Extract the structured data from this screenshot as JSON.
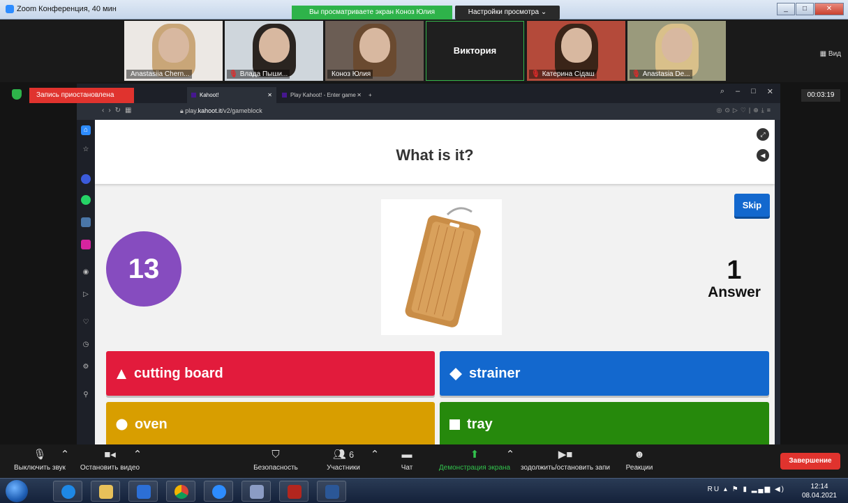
{
  "zoom": {
    "window_title": "Zoom Конференция, 40 мин",
    "share_notice": "Вы просматриваете экран Коноз Юлия",
    "view_options": "Настройки просмотра",
    "view_label": "Вид",
    "recording_status": "Запись приостановлена",
    "timer": "00:03:19",
    "participants": [
      {
        "name": "Anastasiia Chern...",
        "muted": false,
        "hair": "#c9a678",
        "bg": "#ece8e4"
      },
      {
        "name": "Влада Пыши...",
        "muted": true,
        "hair": "#2a2420",
        "bg": "#cfd6dc"
      },
      {
        "name": "Коноз Юлия",
        "muted": false,
        "hair": "#6a4a30",
        "bg": "#6b5d54"
      },
      {
        "name": "Виктория",
        "muted": false,
        "text_only": true
      },
      {
        "name": "Катерина Сідаш",
        "muted": true,
        "hair": "#3a2418",
        "bg": "#b44a3a"
      },
      {
        "name": "Anastasia De...",
        "muted": true,
        "hair": "#d9c08a",
        "bg": "#9a9a7c"
      }
    ],
    "toolbar": {
      "mute": "Выключить звук",
      "stop_video": "Остановить видео",
      "security": "Безопасность",
      "participants": "Участники",
      "participants_count": "6",
      "chat": "Чат",
      "share_screen": "Демонстрация экрана",
      "record": "зодолжить/остановить запи",
      "reactions": "Реакции",
      "end": "Завершение"
    }
  },
  "browser": {
    "tabs": [
      {
        "title": "Kahoot!",
        "active": true
      },
      {
        "title": "Play Kahoot! - Enter game",
        "active": false
      }
    ],
    "url_prefix": "play.",
    "url_domain": "kahoot.it",
    "url_path": "/v2/gameblock"
  },
  "kahoot": {
    "question": "What is it?",
    "time_left": "13",
    "skip_label": "Skip",
    "answers_count": "1",
    "answers_label": "Answer",
    "options": [
      {
        "label": "cutting board",
        "shape": "triangle",
        "color": "#e21b3c"
      },
      {
        "label": "strainer",
        "shape": "diamond",
        "color": "#1368ce"
      },
      {
        "label": "oven",
        "shape": "circle",
        "color": "#d89e00"
      },
      {
        "label": "tray",
        "shape": "square",
        "color": "#26890c"
      }
    ]
  },
  "taskbar": {
    "language": "RU",
    "time": "12:14",
    "date": "08.04.2021"
  }
}
